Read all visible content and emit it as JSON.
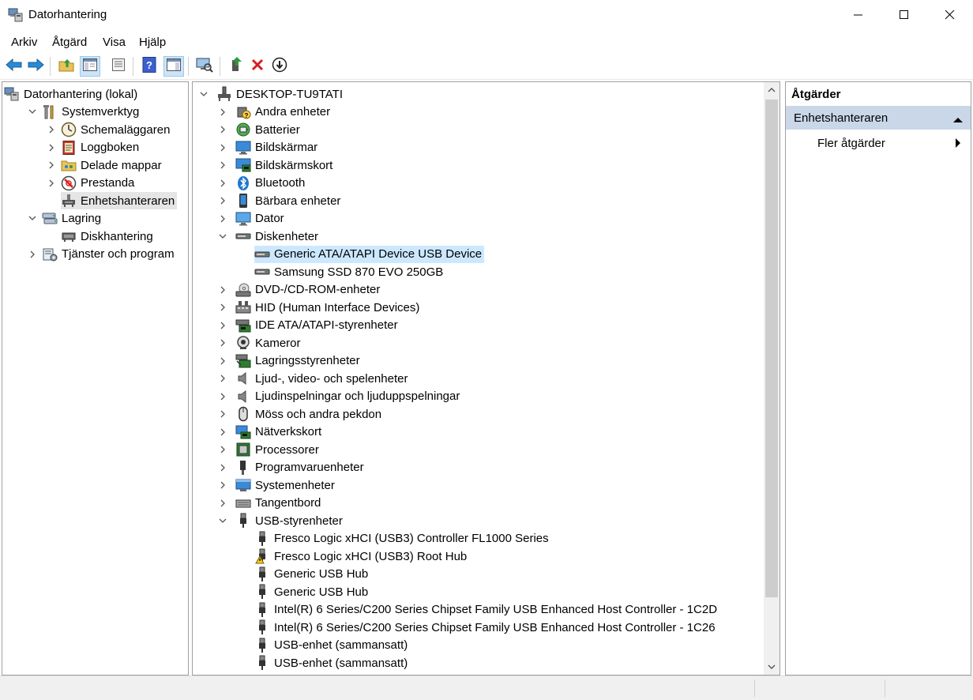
{
  "window": {
    "title": "Datorhantering",
    "app_icon": "computer-management-icon",
    "controls": [
      "minimize-icon",
      "maximize-icon",
      "close-icon"
    ]
  },
  "menu": [
    "Arkiv",
    "Åtgärd",
    "Visa",
    "Hjälp"
  ],
  "toolbar": [
    "back-icon",
    "forward-icon",
    "up-folder-icon",
    "show-hide-tree-icon",
    "properties-icon",
    "help-icon",
    "show-action-pane-icon",
    "scan-hardware-icon",
    "update-driver-icon",
    "uninstall-icon",
    "disable-device-icon"
  ],
  "left_tree": [
    {
      "label": "Datorhantering (lokal)",
      "icon": "computer-management-icon",
      "level": 0,
      "chevron": "none"
    },
    {
      "label": "Systemverktyg",
      "icon": "tools-icon",
      "level": 1,
      "chevron": "down"
    },
    {
      "label": "Schemaläggaren",
      "icon": "clock-icon",
      "level": 2,
      "chevron": "right"
    },
    {
      "label": "Loggboken",
      "icon": "event-log-icon",
      "level": 2,
      "chevron": "right"
    },
    {
      "label": "Delade mappar",
      "icon": "shared-folder-icon",
      "level": 2,
      "chevron": "right"
    },
    {
      "label": "Prestanda",
      "icon": "performance-icon",
      "level": 2,
      "chevron": "right"
    },
    {
      "label": "Enhetshanteraren",
      "icon": "device-manager-icon",
      "level": 2,
      "chevron": "none",
      "selected": true
    },
    {
      "label": "Lagring",
      "icon": "storage-icon",
      "level": 1,
      "chevron": "down"
    },
    {
      "label": "Diskhantering",
      "icon": "disk-management-icon",
      "level": 2,
      "chevron": "none"
    },
    {
      "label": "Tjänster och program",
      "icon": "services-icon",
      "level": 1,
      "chevron": "right"
    }
  ],
  "device_tree": [
    {
      "label": "DESKTOP-TU9TATI",
      "icon": "computer-root-icon",
      "level": 0,
      "chevron": "down"
    },
    {
      "label": "Andra enheter",
      "icon": "unknown-device-icon",
      "level": 1,
      "chevron": "right"
    },
    {
      "label": "Batterier",
      "icon": "battery-icon",
      "level": 1,
      "chevron": "right"
    },
    {
      "label": "Bildskärmar",
      "icon": "monitor-icon",
      "level": 1,
      "chevron": "right"
    },
    {
      "label": "Bildskärmskort",
      "icon": "display-adapter-icon",
      "level": 1,
      "chevron": "right"
    },
    {
      "label": "Bluetooth",
      "icon": "bluetooth-icon",
      "level": 1,
      "chevron": "right"
    },
    {
      "label": "Bärbara enheter",
      "icon": "portable-device-icon",
      "level": 1,
      "chevron": "right"
    },
    {
      "label": "Dator",
      "icon": "computer-icon",
      "level": 1,
      "chevron": "right"
    },
    {
      "label": "Diskenheter",
      "icon": "disk-drive-icon",
      "level": 1,
      "chevron": "down"
    },
    {
      "label": "Generic ATA/ATAPI Device USB Device",
      "icon": "disk-drive-icon",
      "level": 2,
      "chevron": "none",
      "selected": true
    },
    {
      "label": "Samsung SSD 870 EVO 250GB",
      "icon": "disk-drive-icon",
      "level": 2,
      "chevron": "none"
    },
    {
      "label": "DVD-/CD-ROM-enheter",
      "icon": "dvd-drive-icon",
      "level": 1,
      "chevron": "right"
    },
    {
      "label": "HID (Human Interface Devices)",
      "icon": "hid-icon",
      "level": 1,
      "chevron": "right"
    },
    {
      "label": "IDE ATA/ATAPI-styrenheter",
      "icon": "ide-controller-icon",
      "level": 1,
      "chevron": "right"
    },
    {
      "label": "Kameror",
      "icon": "camera-icon",
      "level": 1,
      "chevron": "right"
    },
    {
      "label": "Lagringsstyrenheter",
      "icon": "storage-controller-icon",
      "level": 1,
      "chevron": "right"
    },
    {
      "label": "Ljud-, video- och spelenheter",
      "icon": "speaker-icon",
      "level": 1,
      "chevron": "right"
    },
    {
      "label": "Ljudinspelningar och ljuduppspelningar",
      "icon": "speaker-icon",
      "level": 1,
      "chevron": "right"
    },
    {
      "label": "Möss och andra pekdon",
      "icon": "mouse-icon",
      "level": 1,
      "chevron": "right"
    },
    {
      "label": "Nätverkskort",
      "icon": "network-adapter-icon",
      "level": 1,
      "chevron": "right"
    },
    {
      "label": "Processorer",
      "icon": "processor-icon",
      "level": 1,
      "chevron": "right"
    },
    {
      "label": "Programvaruenheter",
      "icon": "software-device-icon",
      "level": 1,
      "chevron": "right"
    },
    {
      "label": "Systemenheter",
      "icon": "system-device-icon",
      "level": 1,
      "chevron": "right"
    },
    {
      "label": "Tangentbord",
      "icon": "keyboard-icon",
      "level": 1,
      "chevron": "right"
    },
    {
      "label": "USB-styrenheter",
      "icon": "usb-icon",
      "level": 1,
      "chevron": "down"
    },
    {
      "label": "Fresco Logic xHCI (USB3) Controller FL1000 Series",
      "icon": "usb-icon",
      "level": 2,
      "chevron": "none"
    },
    {
      "label": "Fresco Logic xHCI (USB3) Root Hub",
      "icon": "usb-warning-icon",
      "level": 2,
      "chevron": "none"
    },
    {
      "label": "Generic USB Hub",
      "icon": "usb-icon",
      "level": 2,
      "chevron": "none"
    },
    {
      "label": "Generic USB Hub",
      "icon": "usb-icon",
      "level": 2,
      "chevron": "none"
    },
    {
      "label": "Intel(R) 6 Series/C200 Series Chipset Family USB Enhanced Host Controller - 1C2D",
      "icon": "usb-icon",
      "level": 2,
      "chevron": "none"
    },
    {
      "label": "Intel(R) 6 Series/C200 Series Chipset Family USB Enhanced Host Controller - 1C26",
      "icon": "usb-icon",
      "level": 2,
      "chevron": "none"
    },
    {
      "label": "USB-enhet (sammansatt)",
      "icon": "usb-icon",
      "level": 2,
      "chevron": "none"
    },
    {
      "label": "USB-enhet (sammansatt)",
      "icon": "usb-icon",
      "level": 2,
      "chevron": "none"
    }
  ],
  "actions": {
    "header": "Åtgärder",
    "section": "Enhetshanteraren",
    "item": "Fler åtgärder"
  },
  "colors": {
    "selection_blue": "#cce8ff",
    "tree_selection_gray": "#e5e5e5",
    "actions_section": "#c9d7e8"
  }
}
